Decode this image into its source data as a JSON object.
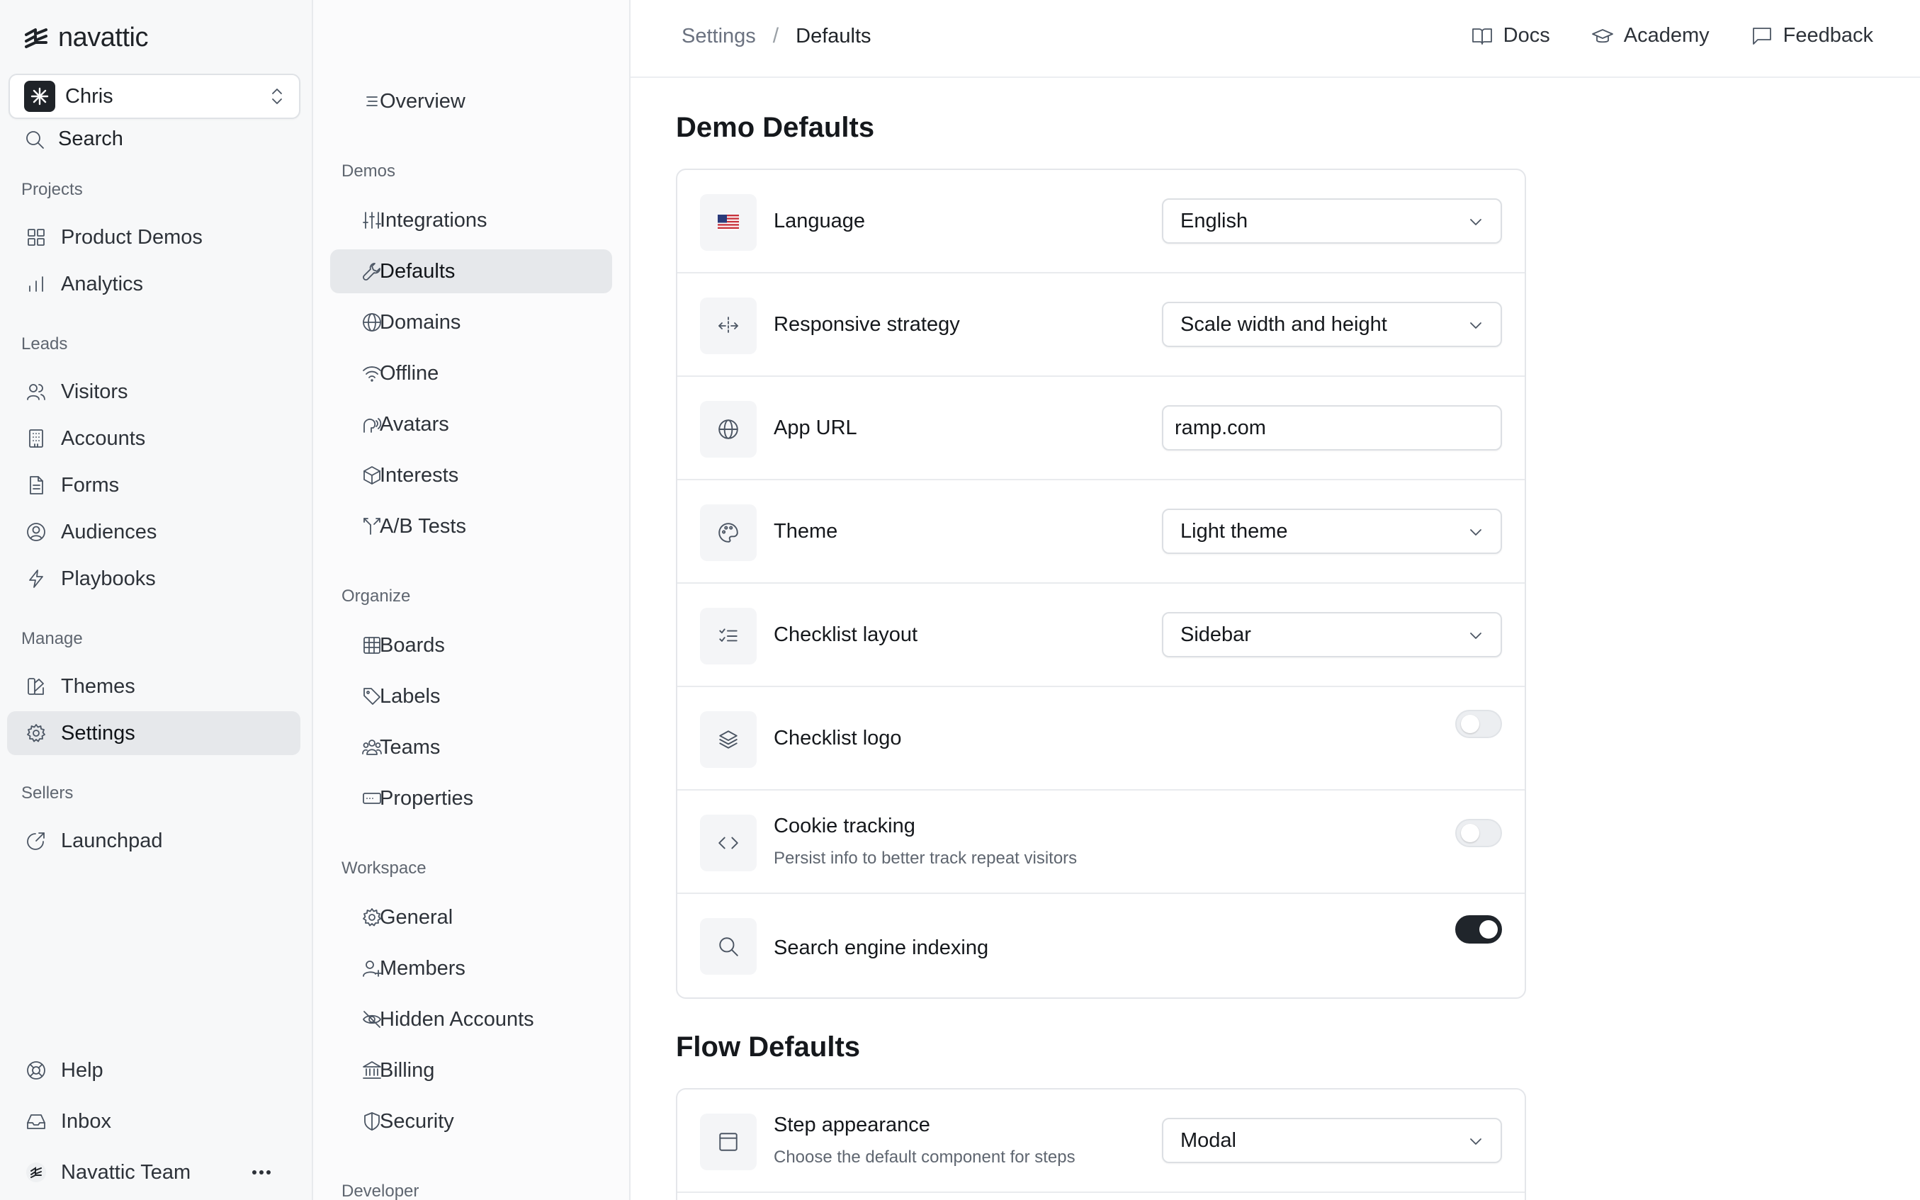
{
  "app": {
    "brand": "navattic"
  },
  "workspace": {
    "name": "Chris"
  },
  "sidebar": {
    "search_label": "Search",
    "sections": {
      "projects": "Projects",
      "leads": "Leads",
      "manage": "Manage",
      "sellers": "Sellers"
    },
    "items": {
      "product_demos": "Product Demos",
      "analytics": "Analytics",
      "visitors": "Visitors",
      "accounts": "Accounts",
      "forms": "Forms",
      "audiences": "Audiences",
      "playbooks": "Playbooks",
      "themes": "Themes",
      "settings": "Settings",
      "launchpad": "Launchpad"
    },
    "footer": {
      "help": "Help",
      "inbox": "Inbox",
      "team": "Navattic Team"
    }
  },
  "subnav": {
    "overview": "Overview",
    "sections": {
      "demos": "Demos",
      "organize": "Organize",
      "workspace": "Workspace",
      "developer": "Developer"
    },
    "items": {
      "integrations": "Integrations",
      "defaults": "Defaults",
      "domains": "Domains",
      "offline": "Offline",
      "avatars": "Avatars",
      "interests": "Interests",
      "ab_tests": "A/B Tests",
      "boards": "Boards",
      "labels": "Labels",
      "teams": "Teams",
      "properties": "Properties",
      "general": "General",
      "members": "Members",
      "hidden_accounts": "Hidden Accounts",
      "billing": "Billing",
      "security": "Security"
    }
  },
  "topbar": {
    "breadcrumb": {
      "parent": "Settings",
      "separator": "/",
      "current": "Defaults"
    },
    "links": {
      "docs": "Docs",
      "academy": "Academy",
      "feedback": "Feedback"
    }
  },
  "demo_defaults": {
    "title": "Demo Defaults",
    "language": {
      "label": "Language",
      "value": "English"
    },
    "responsive": {
      "label": "Responsive strategy",
      "value": "Scale width and height"
    },
    "app_url": {
      "label": "App URL",
      "value": "ramp.com"
    },
    "theme": {
      "label": "Theme",
      "value": "Light theme"
    },
    "checklist_layout": {
      "label": "Checklist layout",
      "value": "Sidebar"
    },
    "checklist_logo": {
      "label": "Checklist logo",
      "enabled": false
    },
    "cookie_tracking": {
      "label": "Cookie tracking",
      "description": "Persist info to better track repeat visitors",
      "enabled": false
    },
    "seo": {
      "label": "Search engine indexing",
      "enabled": true
    }
  },
  "flow_defaults": {
    "title": "Flow Defaults",
    "step_appearance": {
      "label": "Step appearance",
      "description": "Choose the default component for steps",
      "value": "Modal"
    }
  }
}
